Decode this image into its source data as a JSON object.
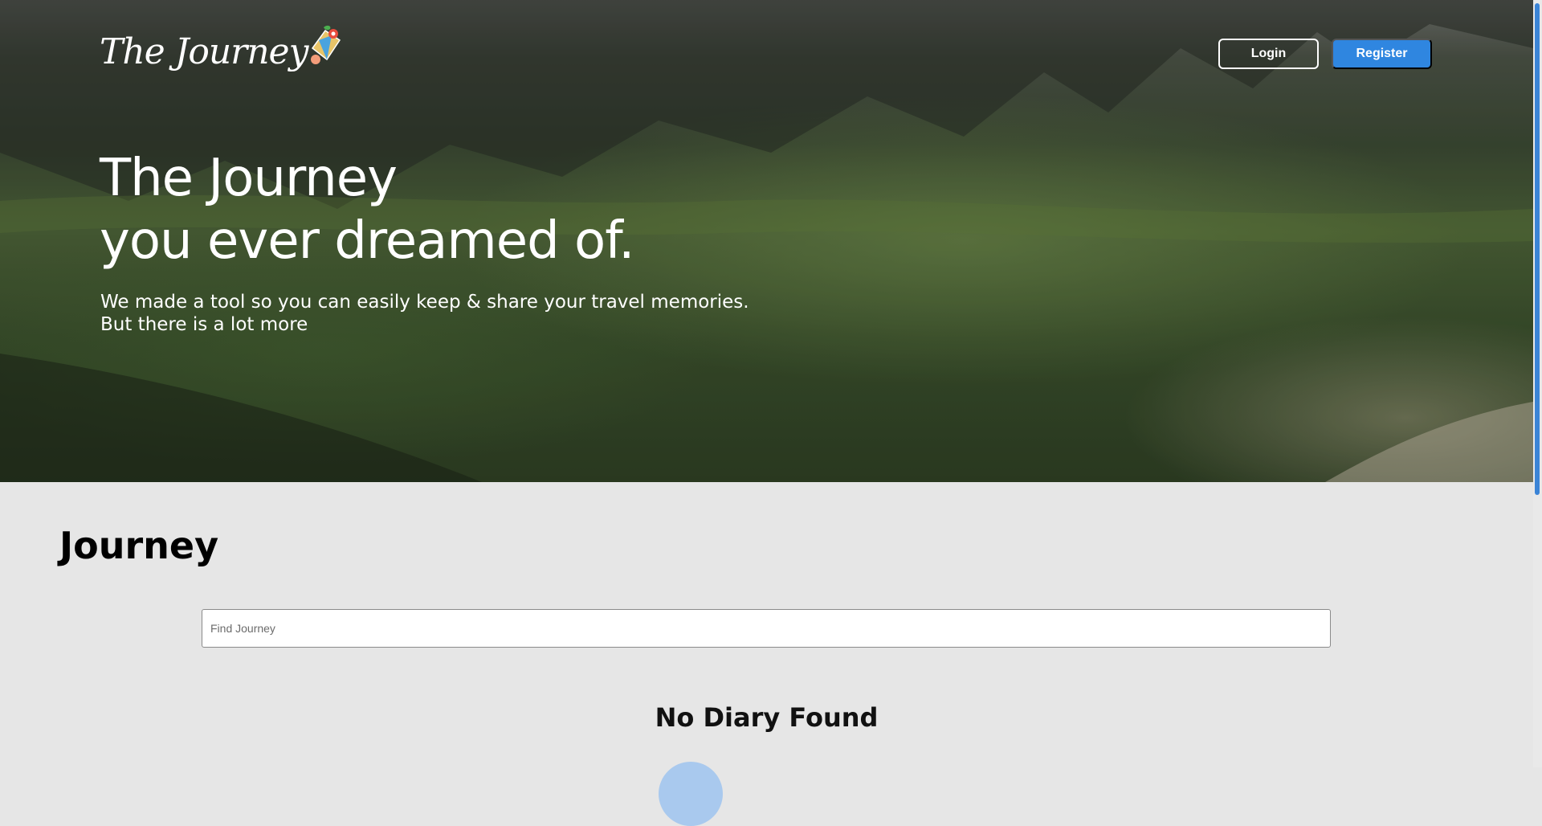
{
  "header": {
    "logo_text": "The Journey",
    "login_label": "Login",
    "register_label": "Register",
    "register_color": "#2f86e0"
  },
  "hero": {
    "title_line1": "The Journey",
    "title_line2": "you ever dreamed of.",
    "subtitle_line1": "We made a tool so you can easily keep & share your travel memories.",
    "subtitle_line2": "But there is a lot more"
  },
  "journey": {
    "heading": "Journey",
    "search_placeholder": "Find Journey",
    "empty_message": "No Diary Found"
  },
  "icons": {
    "logo_decoration": "map-kite-flower-icon",
    "loading": "loading-circle-icon"
  }
}
